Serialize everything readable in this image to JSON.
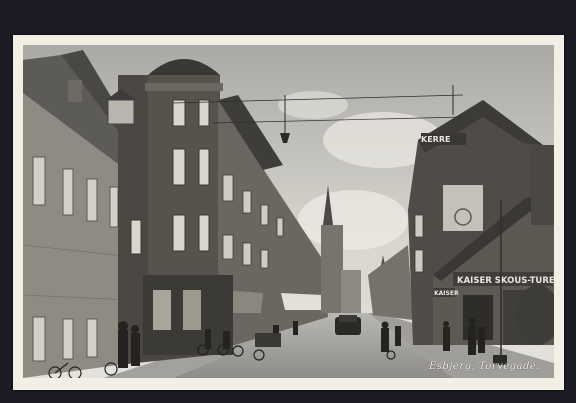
{
  "card": {
    "caption": "Esbjerg, Torvegade.",
    "signs": {
      "kerre": "KERRE",
      "kaiser": "KAISER SKOUS-TURE",
      "kaiser_small": "KAISER"
    }
  }
}
